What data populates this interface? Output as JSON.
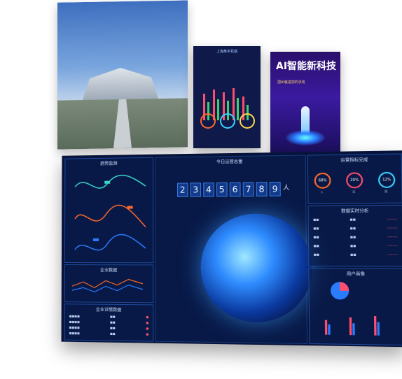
{
  "phone": {
    "title": "上海某手机端"
  },
  "poster": {
    "headline": "AI智能新科技",
    "subtitle": "把AI装进您的手机"
  },
  "dashboard": {
    "left_top_title": "趋势监测",
    "counter_title": "今日运营总量",
    "counter_digits": [
      "2",
      "3",
      "4",
      "5",
      "6",
      "7",
      "8",
      "9"
    ],
    "counter_unit": "人",
    "right_top_title": "运营指标完成",
    "gauges": [
      {
        "value": "68%",
        "label": "入"
      },
      {
        "value": "20%",
        "label": "出"
      },
      {
        "value": "12%",
        "label": "损"
      }
    ],
    "right_mid_title": "数据实时分析",
    "right_bottom_title": "用户画像",
    "left_mid_title": "企业数据",
    "left_bottom_title": "企业详情数据"
  }
}
